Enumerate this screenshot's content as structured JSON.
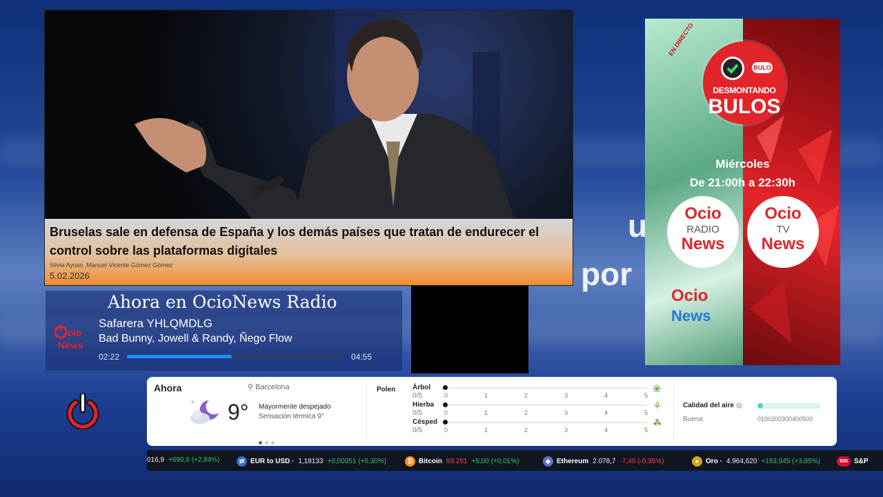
{
  "background": {
    "text_line1": "u",
    "text_line2": "por"
  },
  "news": {
    "title": "Bruselas sale en defensa de España y los demás países que tratan de endurecer el control sobre las plataformas digitales",
    "authors": "Silvia Ayuso ,Manuel Vicente Gómez Gómez",
    "date": "5.02.2026"
  },
  "radio": {
    "heading": "Ahora en OcioNews Radio",
    "song": "Safarera YHLQMDLG",
    "artist": "Bad Bunny, Jowell & Randy, Ñego Flow",
    "elapsed": "02:22",
    "duration": "04:55",
    "progress": 0.48,
    "logo_text": "Ocio News"
  },
  "promo": {
    "tag": "EN DIRECTO",
    "badge_small": "BULO",
    "title_line1": "DESMONTANDO",
    "title_line2": "BULOS",
    "day": "Miércoles",
    "hours": "De 21:00h a 22:30h",
    "radio_logo": {
      "line1": "Ocio",
      "line2": "RADIO",
      "line3": "News"
    },
    "tv_logo": {
      "line1": "Ocio",
      "line2": "TV",
      "line3": "News"
    },
    "mini_logo": {
      "line1": "Ocio",
      "line2": "News"
    },
    "colors": {
      "red": "#e1252b",
      "green": "#6bb592"
    }
  },
  "power": {
    "icon": "power-icon",
    "color": "#e1252b"
  },
  "weather": {
    "now_label": "Ahora",
    "location": "Barcelona",
    "temperature": "9°",
    "condition": "Mayormente despejado",
    "feels_like": "Sensación térmica 9°",
    "icon": "moon-cloud-icon",
    "pages": 3,
    "active_page": 0,
    "pollen_label": "Polen",
    "pollen": [
      {
        "name": "Árbol",
        "score": "0/5",
        "value": 0,
        "icon": "tree-icon"
      },
      {
        "name": "Hierba",
        "score": "0/5",
        "value": 0,
        "icon": "grass-icon"
      },
      {
        "name": "Césped",
        "score": "0/5",
        "value": 0,
        "icon": "lawn-icon"
      }
    ],
    "pollen_ticks": [
      "0",
      "1",
      "2",
      "3",
      "4",
      "5"
    ],
    "air_label": "Calidad del aire",
    "air_status": "Buena",
    "air_scale": "0100200300400500",
    "air_value": 0
  },
  "ticker": [
    {
      "name": "",
      "value": "016,9",
      "change": "+690,0 (+2,84%)",
      "dir": "up",
      "icon": "",
      "color": ""
    },
    {
      "name": "EUR to USD ·",
      "value": "1,18133",
      "change": "+0,00351 (+0,30%)",
      "dir": "up",
      "icon": "currency-icon",
      "color": "#2f6fd6"
    },
    {
      "name": "Bitcoin",
      "value": "69.251",
      "change": "+5,00 (+0,01%)",
      "dir": "up",
      "icon": "bitcoin-icon",
      "color": "#f7931a",
      "value_dir": "down"
    },
    {
      "name": "Ethereum",
      "value": "2.078,7",
      "change": "-7,40 (-0,35%)",
      "dir": "down",
      "icon": "ethereum-icon",
      "color": "#6272c7"
    },
    {
      "name": "Oro ·",
      "value": "4.964,620",
      "change": "+183,945 (+3,85%)",
      "dir": "up",
      "icon": "gold-icon",
      "color": "#d4a61a"
    },
    {
      "name": "S&P",
      "value": "",
      "change": "",
      "dir": "up",
      "icon": "sp500-icon",
      "color": "#d0103a",
      "badge": "500"
    }
  ]
}
